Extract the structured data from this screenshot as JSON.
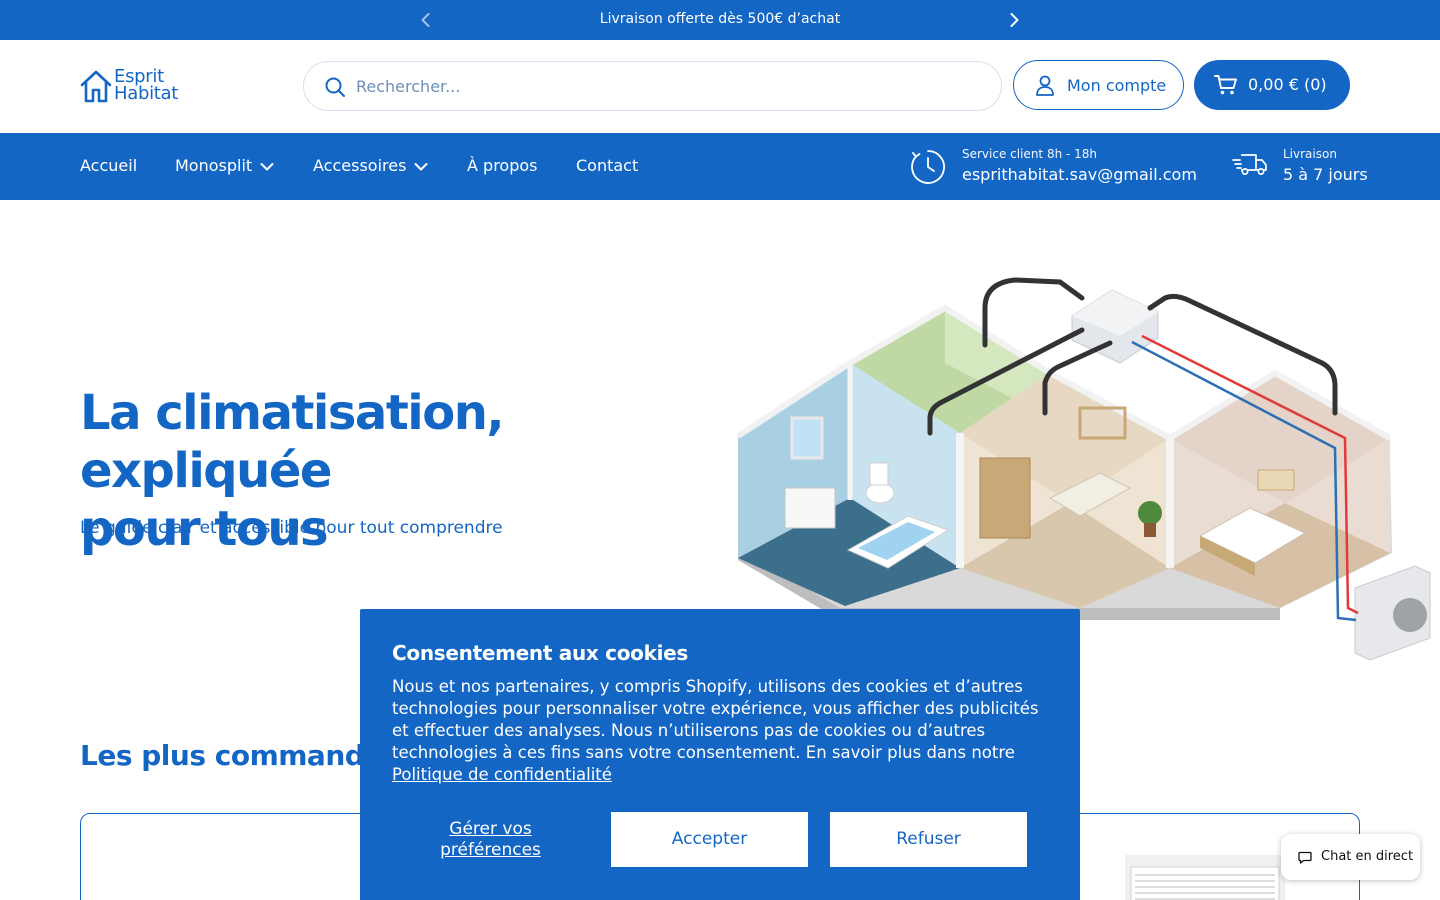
{
  "announcement": {
    "text": "Livraison offerte dès 500€ d’achat",
    "prev_icon": "chevron-left-icon",
    "next_icon": "chevron-right-icon"
  },
  "header": {
    "logo_line1": "Esprit",
    "logo_line2": "Habitat",
    "search_placeholder": "Rechercher...",
    "account_label": "Mon compte",
    "cart_label": "0,00 € (0)"
  },
  "nav": {
    "items": [
      "Accueil",
      "Monosplit",
      "Accessoires",
      "À propos",
      "Contact"
    ],
    "service": {
      "label": "Service client 8h - 18h",
      "value": "esprithabitat.sav@gmail.com"
    },
    "delivery": {
      "label": "Livraison",
      "value": "5 à 7 jours"
    }
  },
  "hero": {
    "title_line1": "La climatisation, expliquée",
    "title_line2": "pour tous",
    "subtitle": "Le guide clair et accessible pour tout comprendre"
  },
  "products": {
    "title": "Les plus commandés"
  },
  "cookie": {
    "title": "Consentement aux cookies",
    "body": "Nous et nos partenaires, y compris Shopify, utilisons des cookies et d’autres technologies pour personnaliser votre expérience, vous afficher des publicités et effectuer des analyses. Nous n’utiliserons pas de cookies ou d’autres technologies à ces fins sans votre consentement. En savoir plus dans notre",
    "link": "Politique de confidentialité",
    "prefs_label": "Gérer vos préférences",
    "accept_label": "Accepter",
    "refuse_label": "Refuser"
  },
  "chat": {
    "label": "Chat en direct"
  },
  "colors": {
    "brand": "#1466c5",
    "white": "#ffffff"
  }
}
